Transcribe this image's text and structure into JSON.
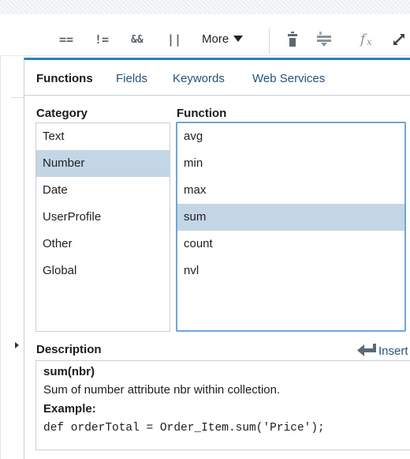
{
  "toolbar": {
    "ops": [
      "==",
      "!=",
      "&&",
      "||"
    ],
    "more_label": "More",
    "icons": [
      "trash-icon",
      "filter-icon",
      "function-fx-icon",
      "expand-icon"
    ]
  },
  "tabs": [
    {
      "label": "Functions",
      "active": true
    },
    {
      "label": "Fields",
      "active": false
    },
    {
      "label": "Keywords",
      "active": false
    },
    {
      "label": "Web Services",
      "active": false
    }
  ],
  "category": {
    "heading": "Category",
    "items": [
      "Text",
      "Number",
      "Date",
      "UserProfile",
      "Other",
      "Global"
    ],
    "selected": "Number"
  },
  "function": {
    "heading": "Function",
    "items": [
      "avg",
      "min",
      "max",
      "sum",
      "count",
      "nvl"
    ],
    "selected": "sum"
  },
  "description": {
    "heading": "Description",
    "insert_label": "Insert",
    "signature": "sum(nbr)",
    "summary": "Sum of number attribute nbr within collection.",
    "example_label": "Example:",
    "example_code": "def orderTotal = Order_Item.sum('Price');"
  },
  "colors": {
    "accent": "#2b7ec1",
    "selection": "#c3d6e6",
    "link": "#24537d"
  }
}
